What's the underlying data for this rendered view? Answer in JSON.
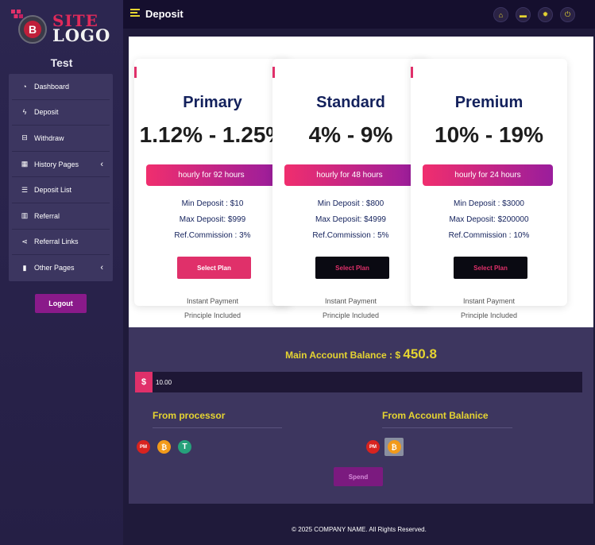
{
  "sidebar": {
    "logo": {
      "site": "SITE",
      "logo": "LOGO",
      "letter": "B"
    },
    "user_name": "Test",
    "items": [
      {
        "label": "Dashboard",
        "icon": "dashboard-icon",
        "glyph": "◔"
      },
      {
        "label": "Deposit",
        "icon": "bolt-icon",
        "glyph": "ϟ"
      },
      {
        "label": "Withdraw",
        "icon": "inbox-icon",
        "glyph": "⊟"
      },
      {
        "label": "History Pages",
        "icon": "table-icon",
        "glyph": "▦",
        "caret": "‹"
      },
      {
        "label": "Deposit List",
        "icon": "list-icon",
        "glyph": "☰"
      },
      {
        "label": "Referral",
        "icon": "chart-icon",
        "glyph": "▥"
      },
      {
        "label": "Referral Links",
        "icon": "share-icon",
        "glyph": "⋖"
      },
      {
        "label": "Other Pages",
        "icon": "file-icon",
        "glyph": "▮",
        "caret": "‹"
      }
    ],
    "logout_label": "Logout"
  },
  "topbar": {
    "title": "Deposit",
    "icons": [
      {
        "name": "home-icon",
        "glyph": "⌂"
      },
      {
        "name": "message-icon",
        "glyph": "▬"
      },
      {
        "name": "settings-icon",
        "glyph": "✹"
      },
      {
        "name": "power-icon",
        "glyph": "⏻"
      }
    ]
  },
  "plans": [
    {
      "name": "Primary",
      "rate": "1.12% - 1.25%",
      "hourly": "hourly for 92 hours",
      "min_deposit": "Min Deposit : $10",
      "max_deposit": "Max Deposit: $999",
      "ref_commission": "Ref.Commission : 3%",
      "button": "Select Plan",
      "button_style": "pink",
      "payment": "Instant Payment",
      "principle": "Principle Included"
    },
    {
      "name": "Standard",
      "rate": "4% - 9%",
      "hourly": "hourly for 48 hours",
      "min_deposit": "Min Deposit : $800",
      "max_deposit": "Max Deposit: $4999",
      "ref_commission": "Ref.Commission : 5%",
      "button": "Select Plan",
      "button_style": "black",
      "payment": "Instant Payment",
      "principle": "Principle Included"
    },
    {
      "name": "Premium",
      "rate": "10% - 19%",
      "hourly": "hourly for 24 hours",
      "min_deposit": "Min Deposit : $3000",
      "max_deposit": "Max Deposit: $200000",
      "ref_commission": "Ref.Commission : 10%",
      "button": "Select Plan",
      "button_style": "black",
      "payment": "Instant Payment",
      "principle": "Principle Included"
    }
  ],
  "balance": {
    "label": "Main Account Balance : $",
    "amount": "450.8",
    "currency_symbol": "$",
    "input_value": "10.00",
    "from_processor": "From processor",
    "from_account": "From Account Balanice",
    "processor_methods": [
      {
        "name": "perfect-money-icon",
        "text": "PM",
        "color": "#d8231f"
      },
      {
        "name": "bitcoin-icon",
        "text": "₿",
        "color": "#f29a1a"
      },
      {
        "name": "tether-icon",
        "text": "T",
        "color": "#26a17b"
      }
    ],
    "account_methods": [
      {
        "name": "perfect-money-icon",
        "text": "PM",
        "color": "#d8231f"
      },
      {
        "name": "bitcoin-icon",
        "text": "₿",
        "color": "#f29a1a",
        "selected": true
      }
    ],
    "spend_label": "Spend"
  },
  "footer": {
    "text": "© 2025 COMPANY NAME. All Rights Reserved."
  },
  "colors": {
    "accent_yellow": "#e5d431",
    "pink": "#e0306a",
    "purple": "#8a1a8a",
    "sidebar": "#2c2650"
  }
}
